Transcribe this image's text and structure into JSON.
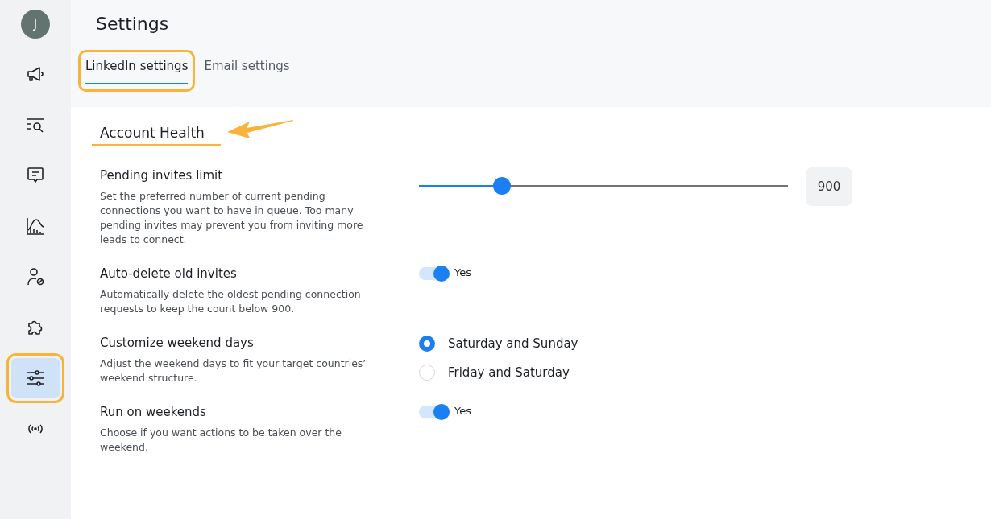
{
  "sidebar": {
    "avatar": "J",
    "items": [
      {
        "selected": false,
        "highlighted": false
      },
      {
        "selected": false,
        "highlighted": false
      },
      {
        "selected": false,
        "highlighted": false
      },
      {
        "selected": false,
        "highlighted": false
      },
      {
        "selected": false,
        "highlighted": false
      },
      {
        "selected": false,
        "highlighted": false
      },
      {
        "selected": true,
        "highlighted": true
      },
      {
        "selected": false,
        "highlighted": false
      }
    ]
  },
  "title": "Settings",
  "tabs": [
    {
      "label": "LinkedIn settings",
      "selected": true,
      "highlighted": true
    },
    {
      "label": "Email settings",
      "selected": false,
      "highlighted": false
    }
  ],
  "section": {
    "heading": "Account Health",
    "annotated": true
  },
  "settings": [
    {
      "kind": "slider",
      "label": "Pending invites limit",
      "description": "Set the preferred number of current pending connections you want to have in queue. Too many pending invites may prevent you from inviting more leads to connect.",
      "level": 0.225,
      "value": "900"
    },
    {
      "kind": "toggle",
      "label": "Auto-delete old invites",
      "description": "Automatically delete the oldest pending connection requests to keep the count below 900.",
      "on": true,
      "state_label": "Yes"
    },
    {
      "kind": "radio",
      "label": "Customize weekend days",
      "description": "Adjust the weekend days to fit your target countries’ weekend structure.",
      "options": [
        {
          "label": "Saturday and Sunday",
          "selected": true
        },
        {
          "label": "Friday and Saturday",
          "selected": false
        }
      ]
    },
    {
      "kind": "toggle",
      "label": "Run on weekends",
      "description": "Choose if you want actions to be taken over the weekend.",
      "on": true,
      "state_label": "Yes"
    }
  ]
}
